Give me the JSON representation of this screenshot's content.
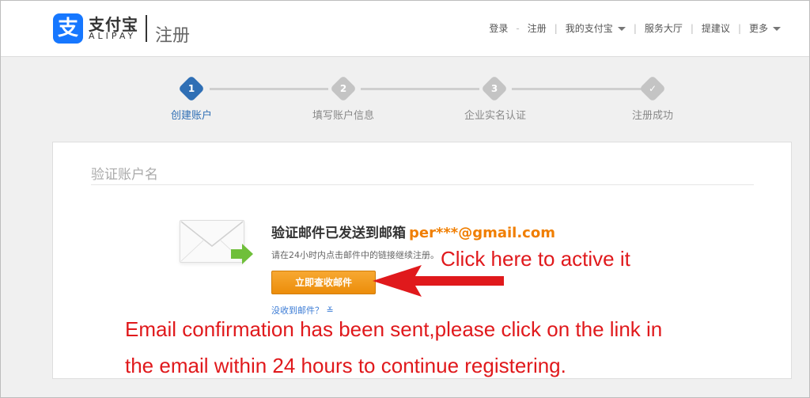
{
  "header": {
    "logo_cn": "支付宝",
    "logo_en": "ALIPAY",
    "logo_glyph": "支",
    "page_name": "注册",
    "nav": [
      {
        "label": "登录"
      },
      {
        "label": "注册"
      },
      {
        "label": "我的支付宝",
        "dropdown": true
      },
      {
        "label": "服务大厅"
      },
      {
        "label": "提建议"
      },
      {
        "label": "更多",
        "dropdown": true
      }
    ]
  },
  "steps": [
    {
      "number": "1",
      "label": "创建账户",
      "state": "active"
    },
    {
      "number": "2",
      "label": "填写账户信息",
      "state": "pending"
    },
    {
      "number": "3",
      "label": "企业实名认证",
      "state": "pending"
    },
    {
      "number": "✓",
      "label": "注册成功",
      "state": "pending"
    }
  ],
  "card": {
    "title": "验证账户名",
    "sent_title": "验证邮件已发送到邮箱",
    "email": "per***@gmail.com",
    "hint": "请在24小时内点击邮件中的链接继续注册。",
    "check_button": "立即查收邮件",
    "not_received": "没收到邮件？"
  },
  "annotations": {
    "click_here": "Click here to active it",
    "line1": "Email confirmation has been sent,please click on the link in",
    "line2": "the email within 24 hours to continue registering."
  },
  "colors": {
    "brand_blue": "#1677ff",
    "step_active": "#2f6fb5",
    "orange": "#f07e00",
    "annotation_red": "#e0191c"
  }
}
